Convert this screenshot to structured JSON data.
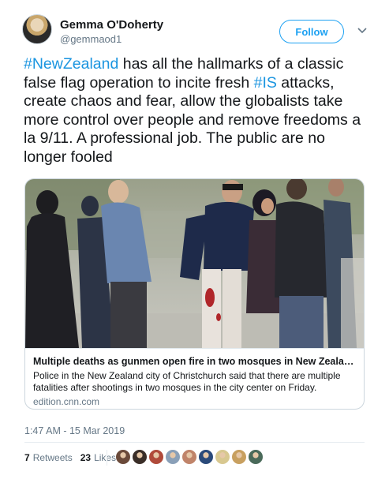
{
  "author": {
    "name": "Gemma O'Doherty",
    "handle": "@gemmaod1"
  },
  "follow_label": "Follow",
  "tweet": {
    "hashtag_1": "#NewZealand",
    "text_1": " has all the hallmarks of a classic false flag operation to incite fresh ",
    "hashtag_2": "#IS",
    "text_2": " attacks, create chaos and fear, allow the globalists take more control over people and remove freedoms a la 9/11. A professional job. The public are no longer fooled"
  },
  "card": {
    "title": "Multiple deaths as gunmen open fire in two mosques in New Zealand's Ch...",
    "description": "Police in the New Zealand city of Christchurch said that there are multiple fatalities after shootings in two mosques in the city center on Friday.",
    "domain": "edition.cnn.com"
  },
  "timestamp": "1:47 AM - 15 Mar 2019",
  "stats": {
    "retweets_count": "7",
    "retweets_label": "Retweets",
    "likes_count": "23",
    "likes_label": "Likes"
  },
  "liker_avatar_colors": [
    "#6b4a3a",
    "#3a2e28",
    "#b04a3a",
    "#8aa0b8",
    "#c0846a",
    "#2a4a7a",
    "#d8c890",
    "#c8a060",
    "#4a6a5a"
  ],
  "colors": {
    "accent": "#1da1f2",
    "hashtag": "#1b95e0",
    "text": "#14171a",
    "secondary": "#657786"
  }
}
